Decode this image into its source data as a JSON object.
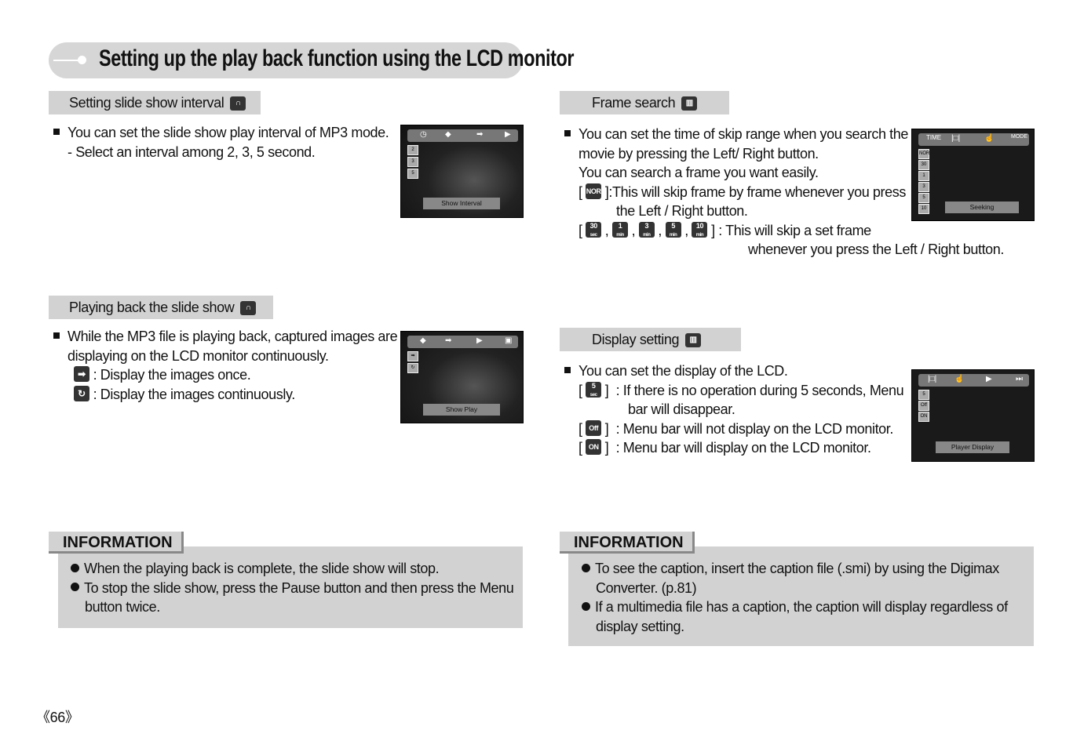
{
  "title": "Setting up the play back function using the LCD monitor",
  "sections": {
    "slide_interval": {
      "header": "Setting slide show interval",
      "icon": "headphones-icon",
      "lines": [
        "You can set the slide show play interval of MP3 mode.",
        "- Select an interval among 2, 3, 5 second."
      ],
      "screen_caption": "Show Interval",
      "side_items": [
        "2",
        "3",
        "5"
      ]
    },
    "playing_back": {
      "header": "Playing back the slide show",
      "icon": "headphones-icon",
      "lines": [
        "While the MP3 file is playing back, captured images are",
        "displaying on the LCD monitor continuously.",
        ": Display the images once.",
        ": Display the images continuously."
      ],
      "screen_caption": "Show Play"
    },
    "frame_search": {
      "header": "Frame search",
      "icon": "film-icon",
      "lines": [
        "You can set the time of skip range when you search the",
        "movie by pressing the Left/ Right button.",
        "You can search a frame you want easily.",
        "]:This will skip frame by frame whenever you press",
        "the Left / Right button.",
        "] : This will skip a set frame",
        "whenever you press the Left / Right button."
      ],
      "icons": [
        {
          "top": "NOR",
          "bottom": ""
        },
        {
          "top": "30",
          "bottom": "sec"
        },
        {
          "top": "1",
          "bottom": "min"
        },
        {
          "top": "3",
          "bottom": "min"
        },
        {
          "top": "5",
          "bottom": "min"
        },
        {
          "top": "10",
          "bottom": "min"
        }
      ],
      "screen_caption": "Seeking",
      "side_items": [
        "NOR",
        "30",
        "1",
        "3",
        "5",
        "10"
      ],
      "bar_label": "TIME",
      "bar_mode": "MODE"
    },
    "display_setting": {
      "header": "Display setting",
      "icon": "film-icon",
      "lines": [
        "You can set the display of the LCD.",
        ": If there is no operation during 5 seconds, Menu",
        "bar will disappear.",
        ": Menu bar will not display on the LCD monitor.",
        ": Menu bar will display on the LCD monitor."
      ],
      "icons": [
        {
          "top": "5",
          "bottom": "sec"
        },
        {
          "top": "Off",
          "bottom": ""
        },
        {
          "top": "ON",
          "bottom": ""
        }
      ],
      "screen_caption": "Player Display",
      "side_items": [
        "5",
        "Off",
        "ON"
      ]
    }
  },
  "info_left": {
    "title": "INFORMATION",
    "lines": [
      "When the playing back is complete, the slide show will stop.",
      "To stop the slide show, press the Pause button and then press the Menu",
      "button twice."
    ]
  },
  "info_right": {
    "title": "INFORMATION",
    "lines": [
      "To see the caption, insert the caption file (.smi) by using the Digimax",
      "Converter. (p.81)",
      "If a multimedia file has a caption, the caption will display regardless of",
      "display setting."
    ]
  },
  "page_number": "《66》"
}
